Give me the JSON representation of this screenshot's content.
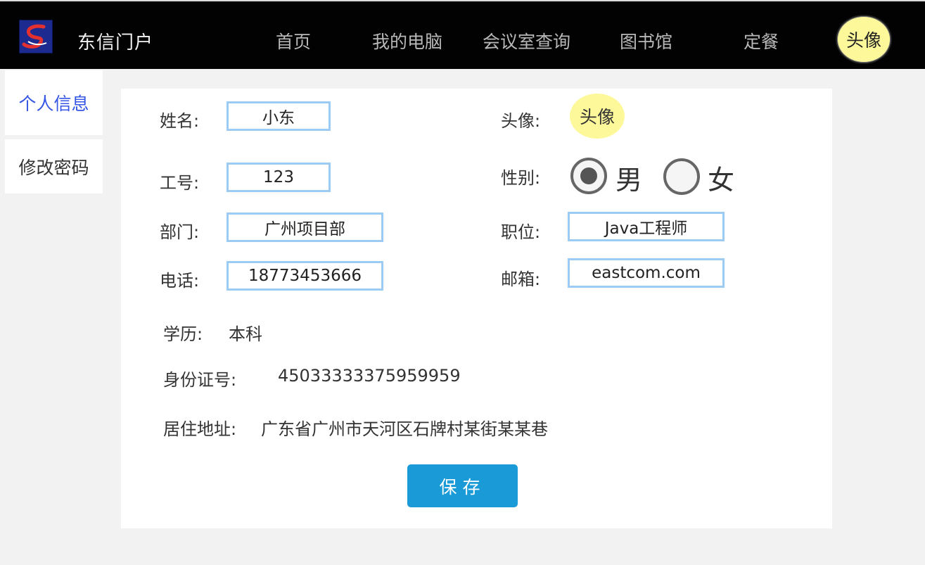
{
  "header": {
    "brand": "东信门户",
    "nav": [
      "首页",
      "我的电脑",
      "会议室查询",
      "图书馆",
      "定餐"
    ],
    "avatar": "头像",
    "colors": {
      "background": "#020202",
      "nav_text": "#b8b8b8",
      "avatar_bg": "#fdf89a"
    }
  },
  "sidebar": {
    "items": [
      {
        "label": "个人信息",
        "active": true
      },
      {
        "label": "修改密码",
        "active": false
      }
    ],
    "active_color": "#3455e5"
  },
  "form": {
    "name": {
      "label": "姓名:",
      "value": "小东"
    },
    "avatar": {
      "label": "头像:",
      "text": "头像"
    },
    "emp_id": {
      "label": "工号:",
      "value": "123"
    },
    "gender": {
      "label": "性别:",
      "options": [
        "男",
        "女"
      ],
      "selected": "男"
    },
    "dept": {
      "label": "部门:",
      "value": "广州项目部"
    },
    "position": {
      "label": "职位:",
      "value": "Java工程师"
    },
    "phone": {
      "label": "电话:",
      "value": "18773453666"
    },
    "email": {
      "label": "邮箱:",
      "value": "eastcom.com"
    },
    "education": {
      "label": "学历:",
      "value": "本科"
    },
    "id_number": {
      "label": "身份证号:",
      "value": "45033333375959959"
    },
    "address": {
      "label": "居住地址:",
      "value": "广东省广州市天河区石牌村某街某某巷"
    },
    "save_label": "保存",
    "colors": {
      "field_border": "#9ccbf3",
      "button": "#1a9ad6"
    }
  }
}
